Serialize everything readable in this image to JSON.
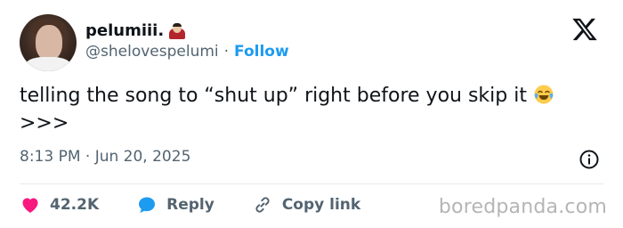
{
  "user": {
    "display_name": "pelumiii.",
    "name_emoji_icon": "vampire-icon",
    "handle": "@shelovespelumi",
    "separator": "·",
    "follow_label": "Follow"
  },
  "tweet": {
    "text": "telling the song to “shut up” right before you skip it",
    "emoji_icon": "tears-of-joy-emoji-icon",
    "suffix": ">>>",
    "timestamp": "8:13 PM · Jun 20, 2025"
  },
  "actions": {
    "likes_count": "42.2K",
    "reply_label": "Reply",
    "copy_link_label": "Copy link"
  },
  "watermark": "boredpanda.com",
  "colors": {
    "like": "#f91880",
    "reply": "#1d9bf0",
    "link": "#1d9bf0",
    "text": "#0f1419",
    "muted": "#536471"
  }
}
